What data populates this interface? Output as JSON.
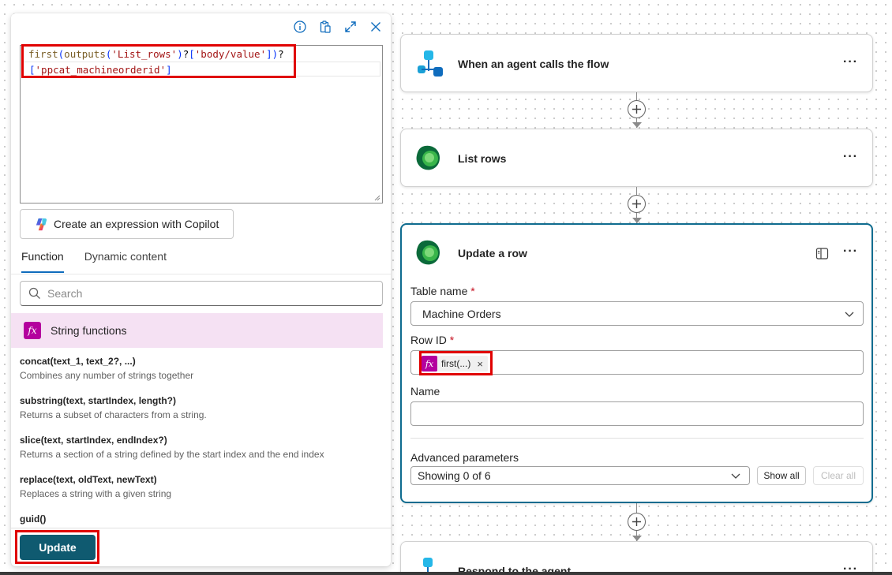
{
  "expression_panel": {
    "toolbar_icons": [
      "info-icon",
      "clipboard-icon",
      "expand-icon",
      "close-icon"
    ],
    "expression_line1": [
      "first",
      "(",
      "outputs",
      "(",
      "'List_rows'",
      ")",
      "?",
      "[",
      "'body/value'",
      "]",
      ")",
      "?"
    ],
    "expression_line2": [
      "[",
      "'ppcat_machineorderid'",
      "]"
    ],
    "copilot_button_label": "Create an expression with Copilot",
    "tabs": [
      {
        "label": "Function",
        "active": true
      },
      {
        "label": "Dynamic content",
        "active": false
      }
    ],
    "search_placeholder": "Search",
    "category": {
      "icon": "fx",
      "label": "String functions"
    },
    "functions": [
      {
        "signature": "concat(text_1, text_2?, ...)",
        "description": "Combines any number of strings together"
      },
      {
        "signature": "substring(text, startIndex, length?)",
        "description": "Returns a subset of characters from a string."
      },
      {
        "signature": "slice(text, startIndex, endIndex?)",
        "description": "Returns a section of a string defined by the start index and the end index"
      },
      {
        "signature": "replace(text, oldText, newText)",
        "description": "Replaces a string with a given string"
      },
      {
        "signature": "guid()",
        "description": ""
      }
    ],
    "update_button_label": "Update"
  },
  "flow": {
    "trigger_card": {
      "title": "When an agent calls the flow",
      "icon": "agent-flow-icon",
      "more": "···"
    },
    "list_rows_card": {
      "title": "List rows",
      "icon": "dataverse-icon",
      "more": "···"
    },
    "update_card": {
      "title": "Update a row",
      "icon": "dataverse-icon",
      "more": "···",
      "table_name_label": "Table name",
      "table_name_value": "Machine Orders",
      "row_id_label": "Row ID",
      "row_id_token": {
        "icon": "fx",
        "label": "first(...)",
        "remove": "×"
      },
      "name_label": "Name",
      "name_value": "",
      "advanced_label": "Advanced parameters",
      "advanced_value": "Showing 0 of 6",
      "show_all_label": "Show all",
      "clear_all_label": "Clear all",
      "required_marker": "*"
    },
    "respond_card": {
      "title": "Respond to the agent",
      "icon": "agent-flow-icon",
      "more": "···"
    }
  },
  "colors": {
    "accent_update_button": "#0f5a70",
    "highlight_red": "#e00000",
    "fx_badge": "#b4009e",
    "category_bg": "#f5e1f3",
    "selected_card_border": "#0f6c8f"
  }
}
